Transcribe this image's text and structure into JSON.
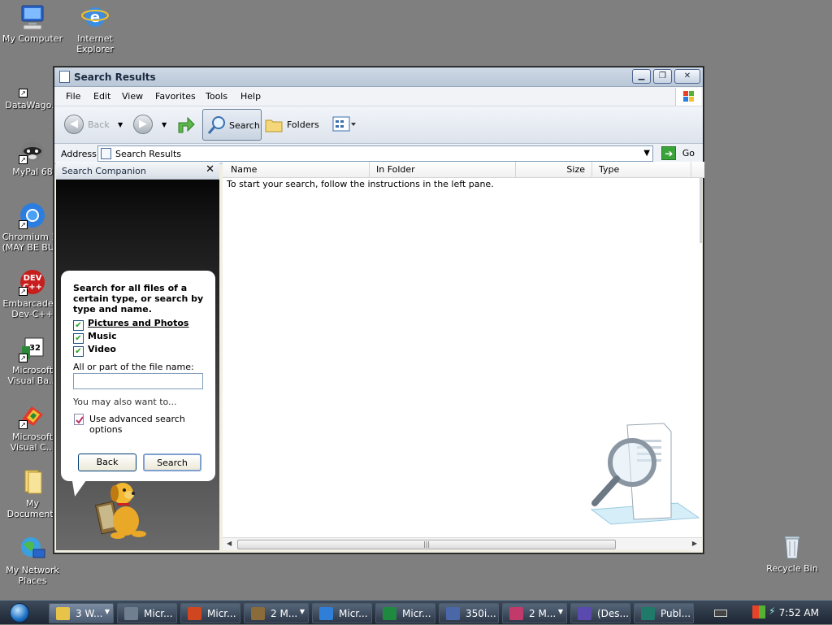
{
  "desktop": {
    "icons": [
      {
        "label": "My Computer"
      },
      {
        "label": "Internet\nExplorer"
      },
      {
        "label": "DataWago..."
      },
      {
        "label": "MyPal 68"
      },
      {
        "label": "Chromium 10\n(MAY BE BU..."
      },
      {
        "label": "Embarcadero\nDev-C++"
      },
      {
        "label": "Microsoft\nVisual Ba..."
      },
      {
        "label": "Microsoft\nVisual C..."
      },
      {
        "label": "My\nDocuments"
      },
      {
        "label": "My Network\nPlaces"
      },
      {
        "label": "Recycle Bin"
      }
    ]
  },
  "window": {
    "title": "Search Results",
    "menu": [
      "File",
      "Edit",
      "View",
      "Favorites",
      "Tools",
      "Help"
    ],
    "toolbar": {
      "back": "Back",
      "search": "Search",
      "folders": "Folders"
    },
    "address": {
      "label": "Address",
      "value": "Search Results",
      "go": "Go"
    },
    "companion": {
      "title": "Search Companion",
      "close": "✕",
      "prompt": "Search for all files of a certain type, or search by type and name.",
      "options": [
        {
          "label": "Pictures and Photos",
          "checked": true
        },
        {
          "label": "Music",
          "checked": true
        },
        {
          "label": "Video",
          "checked": true
        }
      ],
      "filename_label": "All or part of the file name:",
      "filename_value": "",
      "also_label": "You may also want to...",
      "advanced": "Use advanced search options",
      "back_button": "Back",
      "search_button": "Search"
    },
    "results": {
      "columns": [
        "Name",
        "In Folder",
        "Size",
        "Type"
      ],
      "message": "To start your search, follow the instructions in the left pane."
    }
  },
  "taskbar": {
    "tasks": [
      {
        "label": "3 W...",
        "color": "#e8c34a"
      },
      {
        "label": "Micr...",
        "color": "#6f7f90"
      },
      {
        "label": "Micr...",
        "color": "#d0471f"
      },
      {
        "label": "2 M...",
        "color": "#8a6b3a"
      },
      {
        "label": "Micr...",
        "color": "#2f7fd8"
      },
      {
        "label": "Micr...",
        "color": "#1f8a3f"
      },
      {
        "label": "350i...",
        "color": "#4a68a8"
      },
      {
        "label": "2 M...",
        "color": "#c23a6a"
      },
      {
        "label": "(Des...",
        "color": "#5a4ab0"
      },
      {
        "label": "Publ...",
        "color": "#1f7a6a"
      }
    ],
    "clock": "7:52 AM"
  }
}
